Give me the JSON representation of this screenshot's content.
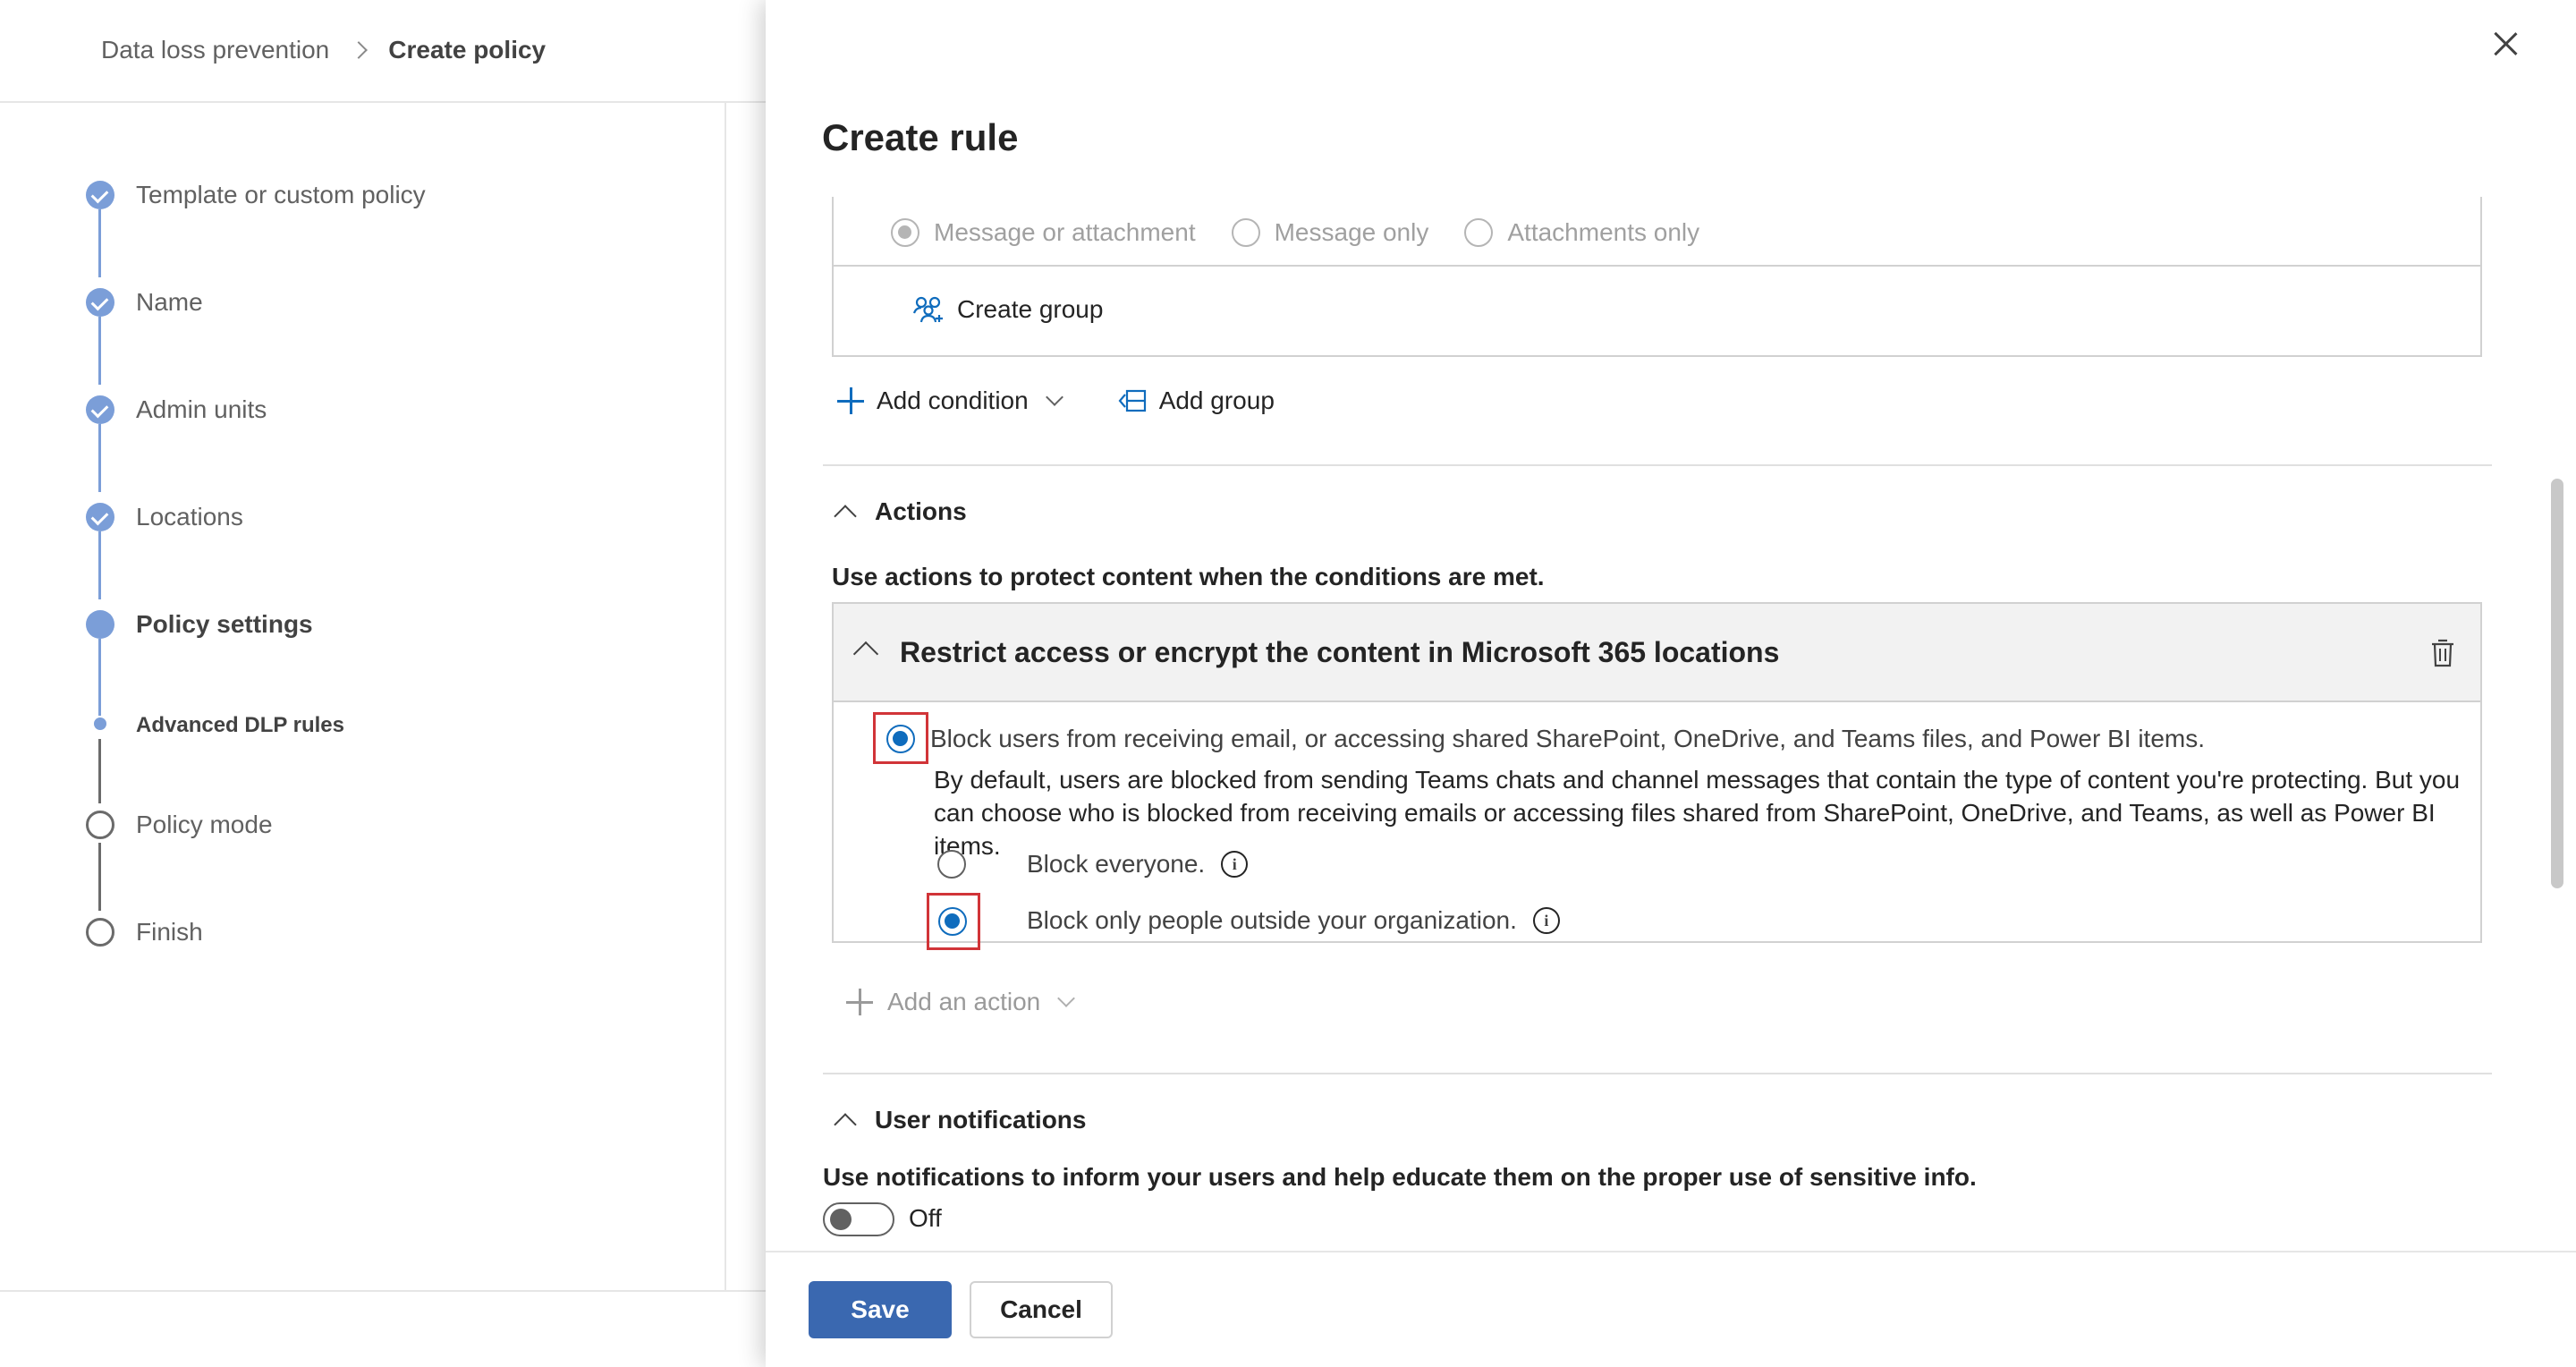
{
  "breadcrumb": {
    "items": [
      "Data loss prevention",
      "Create policy"
    ]
  },
  "wizard": {
    "steps": [
      {
        "label": "Template or custom policy",
        "state": "done"
      },
      {
        "label": "Name",
        "state": "done"
      },
      {
        "label": "Admin units",
        "state": "done"
      },
      {
        "label": "Locations",
        "state": "done"
      },
      {
        "label": "Policy settings",
        "state": "current"
      },
      {
        "label": "Advanced DLP rules",
        "state": "current-sub"
      },
      {
        "label": "Policy mode",
        "state": "pending"
      },
      {
        "label": "Finish",
        "state": "pending"
      }
    ]
  },
  "panel": {
    "title": "Create rule",
    "scope_options": [
      "Message or attachment",
      "Message only",
      "Attachments only"
    ],
    "create_group": "Create group",
    "add_condition": "Add condition",
    "add_group": "Add group",
    "actions": {
      "header": "Actions",
      "description": "Use actions to protect content when the conditions are met.",
      "card_title": "Restrict access or encrypt the content in Microsoft 365 locations",
      "option_block_label": "Block users from receiving email, or accessing shared SharePoint, OneDrive, and Teams files, and Power BI items.",
      "option_block_desc": "By default, users are blocked from sending Teams chats and channel messages that contain the type of content you're protecting. But you can choose who is blocked from receiving emails or accessing files shared from SharePoint, OneDrive, and Teams, as well as Power BI items.",
      "sub_option_everyone": "Block everyone.",
      "sub_option_outside": "Block only people outside your organization.",
      "info_glyph": "i",
      "add_action": "Add an action"
    },
    "notifications": {
      "header": "User notifications",
      "description": "Use notifications to inform your users and help educate them on the proper use of sensitive info.",
      "toggle_state": "Off"
    },
    "footer": {
      "save": "Save",
      "cancel": "Cancel"
    }
  },
  "colors": {
    "accent": "#0f6cbd",
    "primary_button": "#3a68b0",
    "wizard_done": "#7b9ed8",
    "highlight": "#d13438"
  }
}
